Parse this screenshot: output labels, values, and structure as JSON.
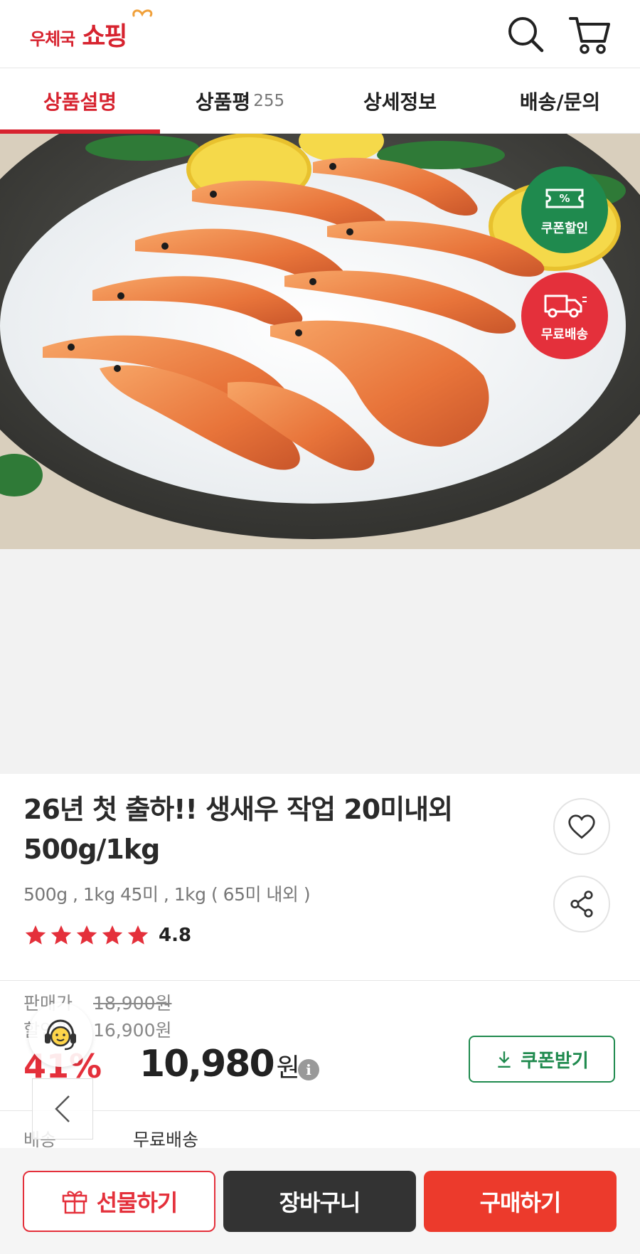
{
  "header": {
    "logo_prefix": "우체국",
    "logo_main": "쇼핑"
  },
  "tabs": [
    {
      "label": "상품설명",
      "count": ""
    },
    {
      "label": "상품평",
      "count": "255"
    },
    {
      "label": "상세정보",
      "count": ""
    },
    {
      "label": "배송/문의",
      "count": ""
    }
  ],
  "badges": {
    "coupon_label": "쿠폰할인",
    "coupon_symbol": "%",
    "shipping_label": "무료배송"
  },
  "product": {
    "title": "26년 첫 출하!! 생새우 작업 20미내외 500g/1kg",
    "options": "500g , 1kg 45미 , 1kg ( 65미 내외 )",
    "rating": "4.8",
    "rating_value": 4.8,
    "rating_max": 5
  },
  "price": {
    "list_label": "판매가",
    "list_price": "18,900원",
    "sale_label": "할인가",
    "sale_price": "16,900원",
    "discount": "41%",
    "final_price": "10,980",
    "final_unit": "원",
    "info_symbol": "i",
    "coupon_button": "쿠폰받기"
  },
  "shipping": {
    "label": "배송",
    "value": "무료배송"
  },
  "bottom_bar": {
    "gift": "선물하기",
    "cart": "장바구니",
    "buy": "구매하기"
  },
  "colors": {
    "brand_red": "#d7232f",
    "coupon_green": "#1f8a4e",
    "buy_red": "#ec3a2c",
    "cart_dark": "#333333"
  }
}
